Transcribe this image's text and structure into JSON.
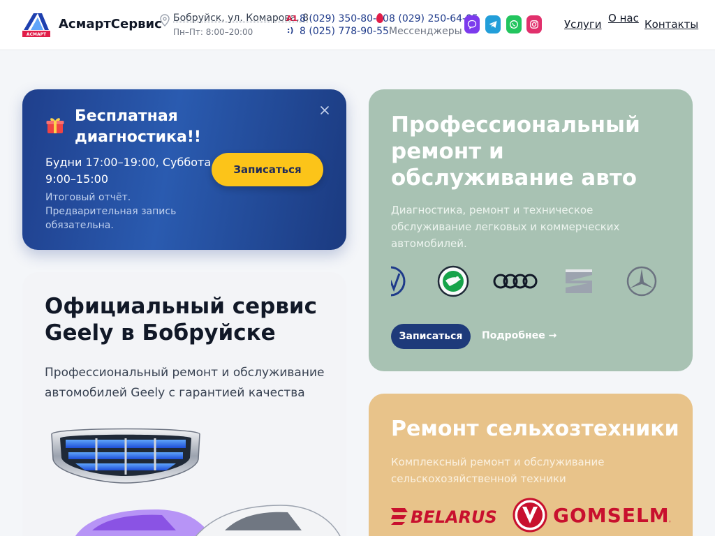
{
  "header": {
    "brand": "АсмартСервис",
    "logo_text": "АСМАРТ",
    "address": "Бобруйск, ул. Комарова, 8",
    "hours": "Пн–Пт: 8:00–20:00",
    "operator_a1": "A1",
    "operator_mts": ":)",
    "phone_1": "8 (029) 350-80-30",
    "phone_2": "8 (025) 778-90-55",
    "phone_3": "8 (029) 250-64-85",
    "messengers_label": "Мессенджеры",
    "social": [
      "viber-icon",
      "telegram-icon",
      "whatsapp-icon",
      "instagram-icon"
    ],
    "nav": {
      "services": "Услуги",
      "about": "О нас",
      "contacts": "Контакты"
    }
  },
  "promo": {
    "title": "Бесплатная диагностика!!",
    "hours": "Будни 17:00–19:00, Суббота 9:00–15:00",
    "note": "Итоговый отчёт. Предварительная запись обязательна.",
    "button": "Записаться"
  },
  "geely": {
    "title": "Официальный сервис Geely в Бобруйске",
    "description": "Профессиональный ремонт и обслуживание автомобилей Geely с гарантией качества"
  },
  "auto": {
    "title": "Профессиональный ремонт и обслуживание авто",
    "description": "Диагностика, ремонт и техническое обслуживание легковых и коммерческих автомобилей.",
    "brands": [
      "volkswagen-logo",
      "skoda-logo",
      "audi-logo",
      "seat-logo",
      "mercedes-logo"
    ],
    "button": "Записаться",
    "more": "Подробнее →"
  },
  "agri": {
    "title": "Ремонт сельхозтехники",
    "description": "Комплексный ремонт и обслуживание сельскохозяйственной техники",
    "brand_1": "BELARUS",
    "brand_2": "GOMSELMASH"
  },
  "colors": {
    "promo_bg": "#1f3f8c",
    "accent_yellow": "#fcc419",
    "auto_bg": "#a8c2b3",
    "agri_bg": "#e8c38a",
    "brand_dark": "#1e3a7a"
  }
}
